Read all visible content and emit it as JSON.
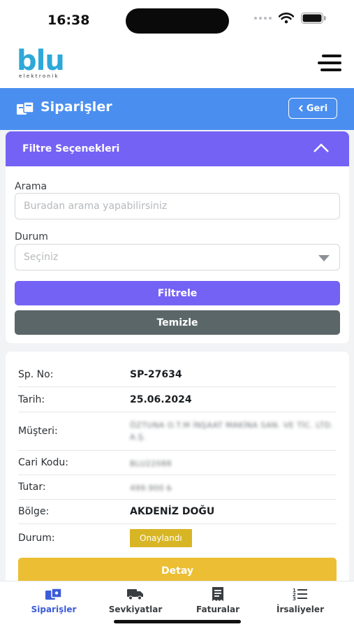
{
  "status_bar": {
    "time": "16:38"
  },
  "header": {
    "logo_text": "blu",
    "logo_subtext": "elektronik",
    "menu_icon": "hamburger-menu-icon"
  },
  "title_bar": {
    "title": "Siparişler",
    "back_label": "Geri",
    "icon": "orders-icon"
  },
  "filter": {
    "title": "Filtre Seçenekleri",
    "search_label": "Arama",
    "search_placeholder": "Buradan arama yapabilirsiniz",
    "status_label": "Durum",
    "status_selected": "Seçiniz",
    "filter_button": "Filtrele",
    "clear_button": "Temizle"
  },
  "order": {
    "rows": [
      {
        "label": "Sp. No:",
        "value": "SP-27634"
      },
      {
        "label": "Tarih:",
        "value": "25.06.2024"
      },
      {
        "label": "Müşteri:",
        "value": "ÖZTUNA O.T.M İNŞAAT MAKİNA SAN. VE TİC. LTD. A.Ş."
      },
      {
        "label": "Cari Kodu:",
        "value": "BLU22088"
      },
      {
        "label": "Tutar:",
        "value": "499.900 ₺"
      },
      {
        "label": "Bölge:",
        "value": "AKDENİZ DOĞU"
      },
      {
        "label": "Durum:",
        "value": "Onaylandı"
      }
    ],
    "detail_button": "Detay"
  },
  "tabs": [
    {
      "label": "Siparişler",
      "icon": "orders-icon",
      "active": true
    },
    {
      "label": "Sevkiyatlar",
      "icon": "truck-icon",
      "active": false
    },
    {
      "label": "Faturalar",
      "icon": "receipt-icon",
      "active": false
    },
    {
      "label": "İrsaliyeler",
      "icon": "numbered-list-icon",
      "active": false
    }
  ],
  "colors": {
    "primary_blue": "#4a8ff0",
    "purple": "#7462f5",
    "gray_button": "#5b6668",
    "badge_yellow": "#d8b524",
    "detail_yellow": "#ecbe33",
    "logo_blue": "#2ea8d9",
    "active_tab": "#3b5bd9"
  }
}
